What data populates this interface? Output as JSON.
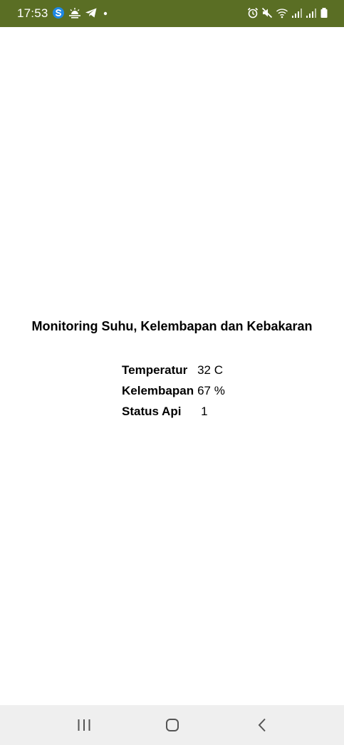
{
  "status_bar": {
    "time": "17:53",
    "bg_color": "#5a6e24",
    "left_icons": [
      "app-s-icon",
      "weather-icon",
      "telegram-icon",
      "notification-dot-icon"
    ],
    "right_icons": [
      "alarm-icon",
      "mute-icon",
      "wifi-icon",
      "signal-icon",
      "signal-icon",
      "battery-icon"
    ]
  },
  "main": {
    "title": "Monitoring Suhu, Kelembapan dan Kebakaran",
    "rows": [
      {
        "label": "Temperatur",
        "value": "32 C"
      },
      {
        "label": "Kelembapan",
        "value": "67 %"
      },
      {
        "label": "Status Api",
        "value": "1"
      }
    ]
  },
  "nav_bar": {
    "bg_color": "#efefef",
    "buttons": [
      "recents-icon",
      "home-icon",
      "back-icon"
    ]
  }
}
